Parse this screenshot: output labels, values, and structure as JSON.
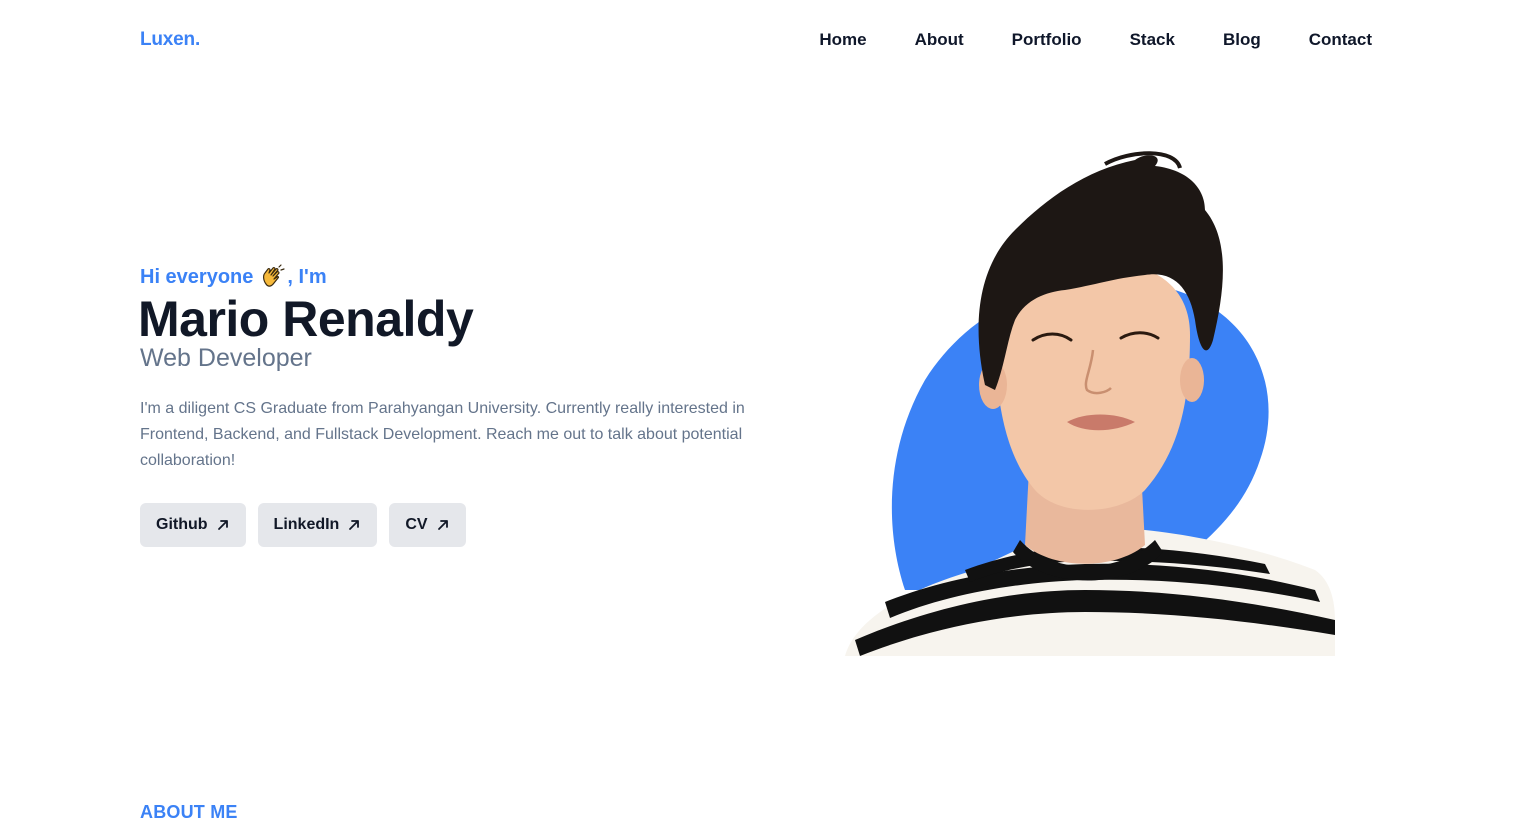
{
  "brand": {
    "logo": "Luxen."
  },
  "nav": {
    "items": [
      "Home",
      "About",
      "Portfolio",
      "Stack",
      "Blog",
      "Contact"
    ]
  },
  "hero": {
    "greeting_prefix": "Hi everyone",
    "greeting_suffix": ", I'm",
    "greeting_icon": "waving-hand-icon",
    "name": "Mario Renaldy",
    "role": "Web Developer",
    "bio": "I'm a diligent CS Graduate from Parahyangan University. Currently really interested in Frontend, Backend, and Fullstack Development. Reach me out to talk about potential collaboration!",
    "buttons": [
      {
        "label": "Github",
        "icon": "arrow-up-right-icon"
      },
      {
        "label": "LinkedIn",
        "icon": "arrow-up-right-icon"
      },
      {
        "label": "CV",
        "icon": "arrow-up-right-icon"
      }
    ]
  },
  "about": {
    "label": "ABOUT ME"
  },
  "colors": {
    "accent": "#3b82f6",
    "heading": "#111827",
    "muted": "#64748b",
    "button_bg": "#e5e7eb"
  }
}
